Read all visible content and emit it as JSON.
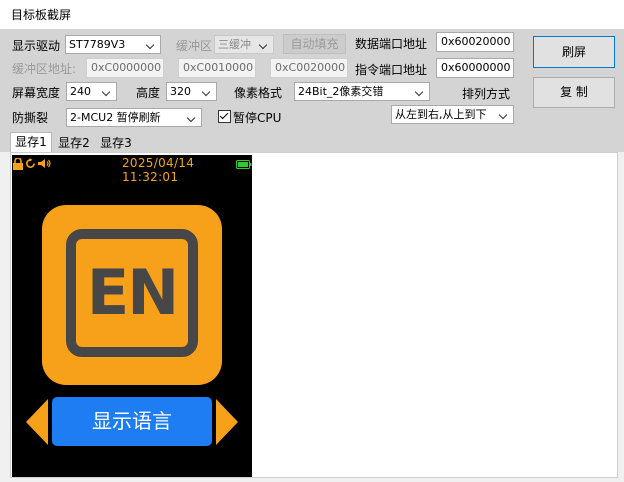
{
  "window": {
    "title": "目标板截屏"
  },
  "toolbar": {
    "display_driver_label": "显示驱动",
    "display_driver_value": "ST7789V3",
    "buffer_area_label": "缓冲区",
    "buffer_area_value": "三缓冲",
    "autofill_button": "自动填充",
    "data_port_label": "数据端口地址",
    "data_port_value": "0x60020000",
    "buffer_addr_label": "缓冲区地址:",
    "buffer_addr_1": "0xC0000000",
    "buffer_addr_2": "0xC0010000",
    "buffer_addr_3": "0xC0020000",
    "cmd_port_label": "指令端口地址",
    "cmd_port_value": "0x60000000",
    "width_label": "屏幕宽度",
    "width_value": "240",
    "height_label": "高度",
    "height_value": "320",
    "pixel_format_label": "像素格式",
    "pixel_format_value": "24Bit_2像素交错",
    "order_label": "排列方式",
    "order_value": "从左到右,从上到下",
    "anti_tear_label": "防撕裂",
    "anti_tear_value": "2-MCU2 暂停刷新",
    "pause_cpu_label": "暂停CPU",
    "pause_cpu_checked": true,
    "refresh_button": "刷屏",
    "copy_button": "复 制"
  },
  "tabs": [
    {
      "label": "显存1",
      "active": true
    },
    {
      "label": "显存2",
      "active": false
    },
    {
      "label": "显存3",
      "active": false
    }
  ],
  "device_screen": {
    "clock": "2025/04/14 11:32:01",
    "app_icon_text": "EN",
    "language_button": "显示语言",
    "colors": {
      "orange": "#f7a01a",
      "blue": "#1f7df4",
      "icon_gray": "#474747",
      "battery_green": "#2ecc2e"
    }
  }
}
